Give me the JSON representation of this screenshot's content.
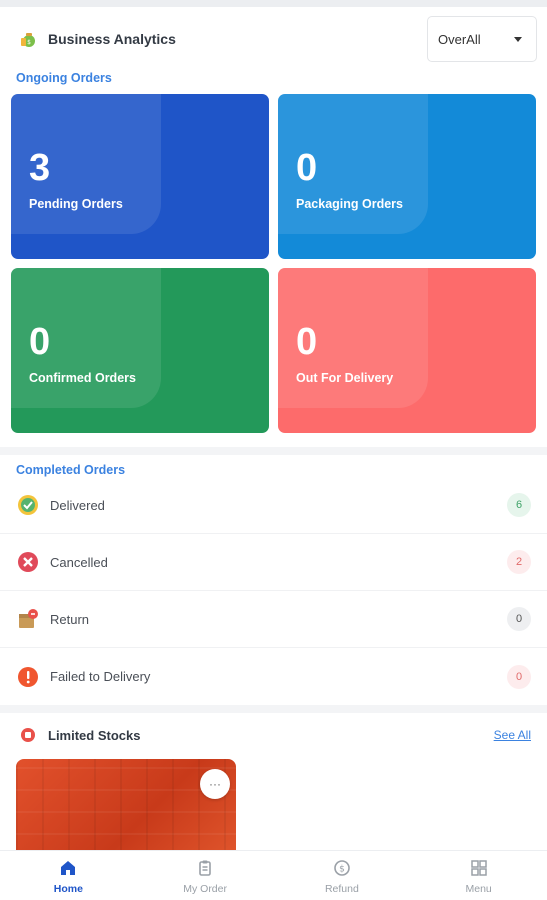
{
  "header": {
    "title": "Business Analytics",
    "filter_value": "OverAll"
  },
  "ongoing": {
    "section_label": "Ongoing Orders",
    "cards": [
      {
        "count": "3",
        "label": "Pending Orders",
        "color": "#1f55c8"
      },
      {
        "count": "0",
        "label": "Packaging Orders",
        "color": "#138ad8"
      },
      {
        "count": "0",
        "label": "Confirmed Orders",
        "color": "#23995a"
      },
      {
        "count": "0",
        "label": "Out For Delivery",
        "color": "#fd6b6b"
      }
    ]
  },
  "completed": {
    "section_label": "Completed Orders",
    "rows": [
      {
        "label": "Delivered",
        "count": "6",
        "icon": "delivered-icon"
      },
      {
        "label": "Cancelled",
        "count": "2",
        "icon": "cancelled-icon"
      },
      {
        "label": "Return",
        "count": "0",
        "icon": "return-icon"
      },
      {
        "label": "Failed to Delivery",
        "count": "0",
        "icon": "failed-icon"
      }
    ]
  },
  "limited_stocks": {
    "title": "Limited Stocks",
    "see_all": "See All",
    "more": "···"
  },
  "bottom_nav": [
    {
      "label": "Home",
      "icon": "home-icon",
      "active": true
    },
    {
      "label": "My Order",
      "icon": "clipboard-icon",
      "active": false
    },
    {
      "label": "Refund",
      "icon": "refund-icon",
      "active": false
    },
    {
      "label": "Menu",
      "icon": "grid-icon",
      "active": false
    }
  ]
}
